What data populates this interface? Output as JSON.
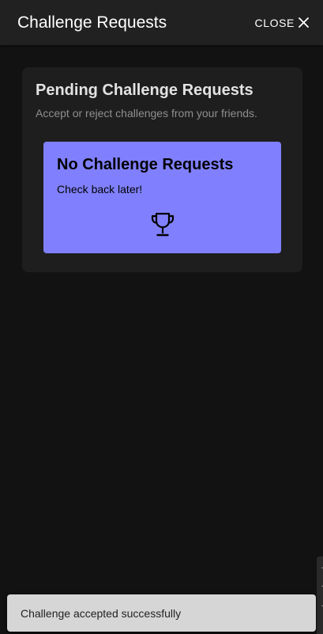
{
  "header": {
    "title": "Challenge Requests",
    "close_label": "CLOSE",
    "close_icon": "close-icon"
  },
  "panel": {
    "title": "Pending Challenge Requests",
    "subtitle": "Accept or reject challenges from your friends."
  },
  "empty_state": {
    "title": "No Challenge Requests",
    "message": "Check back later!",
    "icon": "trophy-icon"
  },
  "snackbar": {
    "message": "Challenge accepted successfully"
  },
  "colors": {
    "background": "#121212",
    "header": "#212121",
    "panel": "#1e1e1e",
    "accent": "#8080ff",
    "snackbar": "#d6d6d6"
  }
}
